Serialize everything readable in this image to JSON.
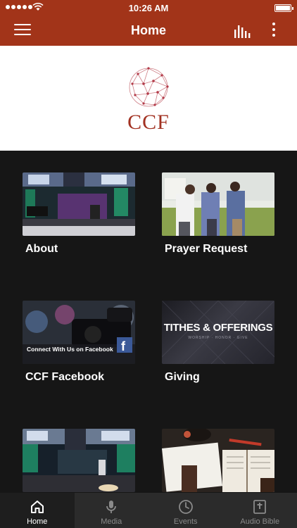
{
  "status": {
    "time": "10:26 AM"
  },
  "nav": {
    "title": "Home"
  },
  "logo": {
    "text": "CCF"
  },
  "tiles": [
    {
      "label": "About"
    },
    {
      "label": "Prayer Request"
    },
    {
      "label": "CCF Facebook",
      "overlay_text": "Connect With Us on Facebook"
    },
    {
      "label": "Giving",
      "overlay_title": "TITHES & OFFERINGS",
      "overlay_subtitle": "WORSHIP · HONOR · GIVE"
    },
    {
      "label": ""
    },
    {
      "label": ""
    }
  ],
  "tabs": [
    {
      "label": "Home",
      "icon": "home-icon",
      "active": true
    },
    {
      "label": "Media",
      "icon": "microphone-icon",
      "active": false
    },
    {
      "label": "Events",
      "icon": "clock-icon",
      "active": false
    },
    {
      "label": "Audio Bible",
      "icon": "bible-icon",
      "active": false
    }
  ],
  "colors": {
    "brand": "#a23419",
    "logo": "#a23222",
    "background": "#161616",
    "tab_bar": "#2b2b2b"
  }
}
